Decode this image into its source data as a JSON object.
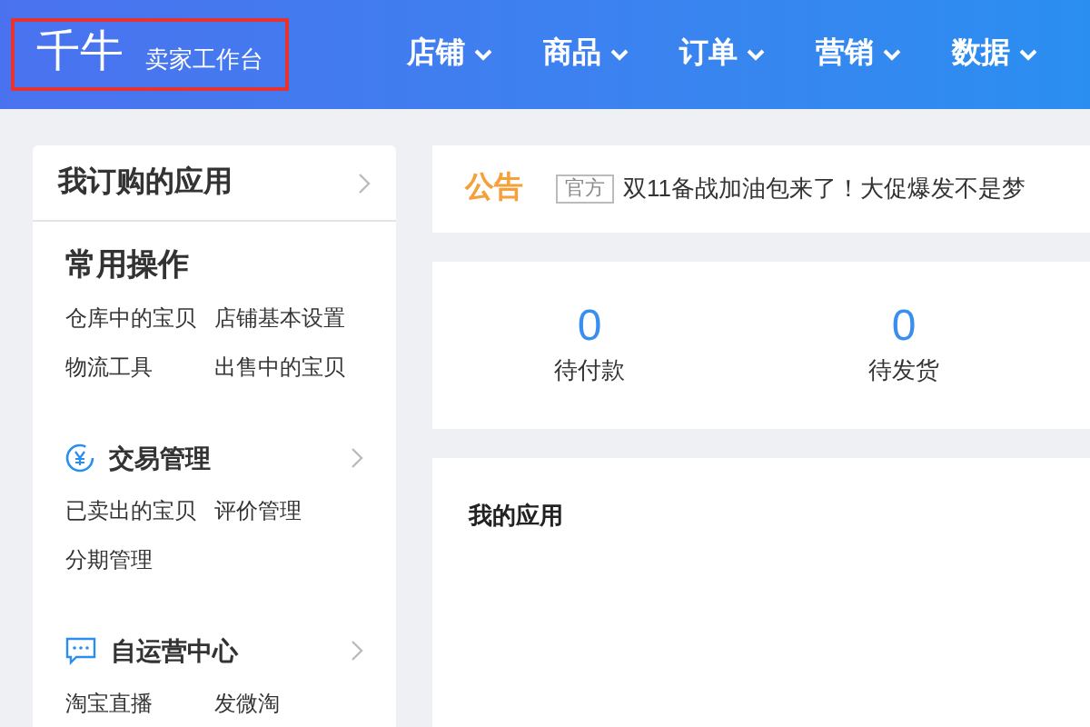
{
  "header": {
    "logo": "千牛",
    "subtitle": "卖家工作台",
    "logo_highlighted": true,
    "nav": [
      {
        "label": "店铺"
      },
      {
        "label": "商品"
      },
      {
        "label": "订单"
      },
      {
        "label": "营销"
      },
      {
        "label": "数据"
      }
    ]
  },
  "sidebar": {
    "title": "我订购的应用",
    "sections": [
      {
        "kind": "plain",
        "title": "常用操作",
        "links": [
          "仓库中的宝贝",
          "店铺基本设置",
          "物流工具",
          "出售中的宝贝"
        ]
      },
      {
        "kind": "yuan",
        "title": "交易管理",
        "links": [
          "已卖出的宝贝",
          "评价管理",
          "分期管理"
        ]
      },
      {
        "kind": "chat",
        "title": "自运营中心",
        "links": [
          "淘宝直播",
          "发微淘"
        ]
      }
    ]
  },
  "notice": {
    "label": "公告",
    "tag": "官方",
    "text": "双11备战加油包来了！大促爆发不是梦"
  },
  "stats": [
    {
      "value": "0",
      "label": "待付款"
    },
    {
      "value": "0",
      "label": "待发货"
    }
  ],
  "my_apps": {
    "title": "我的应用"
  }
}
